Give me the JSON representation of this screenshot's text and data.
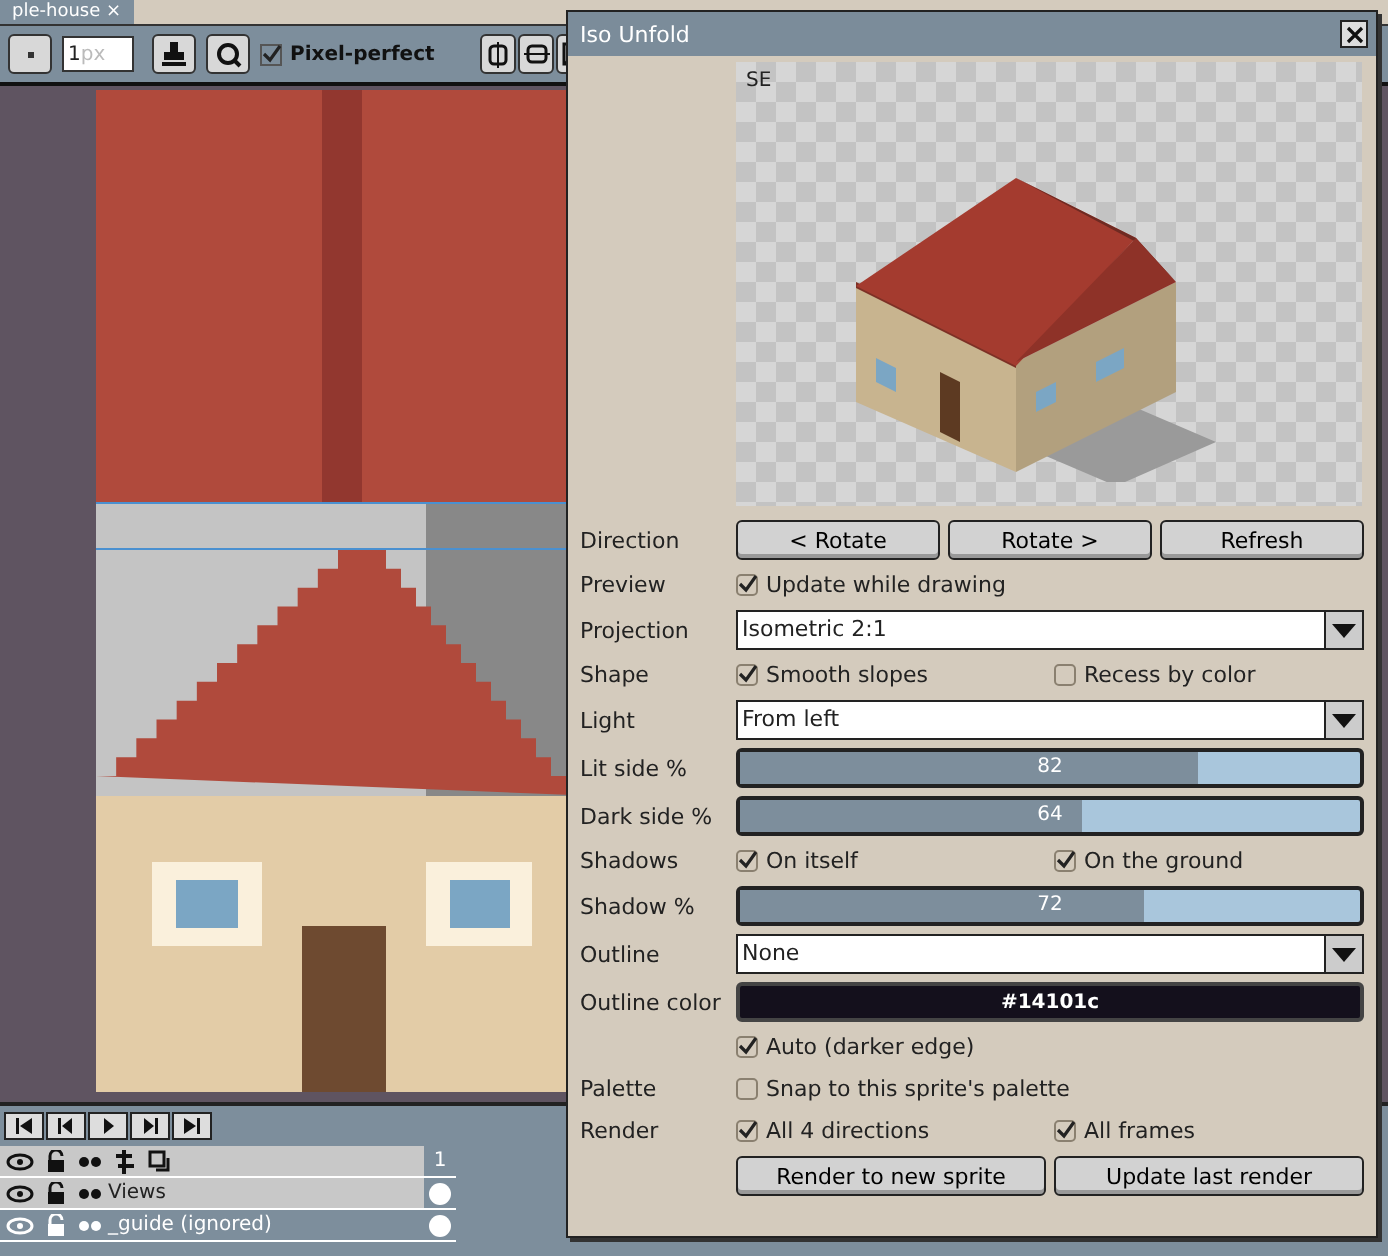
{
  "document_tab": {
    "title": "ple-house",
    "close": "×"
  },
  "toolbar": {
    "brush_size": "1",
    "brush_unit": "px",
    "pixel_perfect": {
      "label": "Pixel-perfect",
      "checked": true
    }
  },
  "dialog": {
    "title": "Iso Unfold",
    "preview_direction": "SE",
    "rows": [
      {
        "kind": "buttons",
        "label": "Direction",
        "buttons": [
          "< Rotate",
          "Rotate >",
          "Refresh"
        ]
      },
      {
        "kind": "checks",
        "label": "Preview",
        "checks": [
          {
            "label": "Update while drawing",
            "checked": true
          }
        ]
      },
      {
        "kind": "dropdown",
        "label": "Projection",
        "value": "Isometric 2:1"
      },
      {
        "kind": "checks",
        "label": "Shape",
        "checks": [
          {
            "label": "Smooth slopes",
            "checked": true
          },
          {
            "label": "Recess by color",
            "checked": false
          }
        ]
      },
      {
        "kind": "dropdown",
        "label": "Light",
        "value": "From left"
      },
      {
        "kind": "slider",
        "label": "Lit side %",
        "level": 0.74,
        "reading": "82"
      },
      {
        "kind": "slider",
        "label": "Dark side %",
        "level": 0.55,
        "reading": "64"
      },
      {
        "kind": "checks",
        "label": "Shadows",
        "checks": [
          {
            "label": "On itself",
            "checked": true
          },
          {
            "label": "On the ground",
            "checked": true
          }
        ]
      },
      {
        "kind": "slider",
        "label": "Shadow %",
        "level": 0.65,
        "reading": "72"
      },
      {
        "kind": "dropdown",
        "label": "Outline",
        "value": "None"
      },
      {
        "kind": "color",
        "label": "Outline color",
        "value": "#14101c",
        "color": "#14101c"
      },
      {
        "kind": "checks",
        "checks": [
          {
            "label": "Auto (darker edge)",
            "checked": true
          }
        ]
      },
      {
        "kind": "checks",
        "label": "Palette",
        "checks": [
          {
            "label": "Snap to this sprite's palette",
            "checked": false
          }
        ]
      },
      {
        "kind": "checks",
        "label": "Render",
        "checks": [
          {
            "label": "All 4 directions",
            "checked": true
          },
          {
            "label": "All frames",
            "checked": true
          }
        ]
      },
      {
        "kind": "buttons",
        "buttons": [
          "Render to new sprite",
          "Update last render"
        ]
      }
    ]
  },
  "timeline": {
    "frame": "1",
    "layers": [
      {
        "name": "Views",
        "selected": false
      },
      {
        "name": "_guide (ignored)",
        "selected": true
      }
    ]
  }
}
